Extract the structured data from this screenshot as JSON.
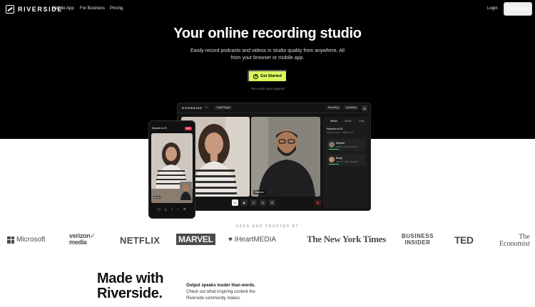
{
  "nav": {
    "brand": "RIVERSIDE",
    "links": [
      "Mobile App",
      "For Business",
      "Pricing"
    ],
    "login": "Login",
    "cta": "Get Started"
  },
  "hero": {
    "title": "Your online recording studio",
    "subtitle": "Easily record podcasts and videos in studio quality from anywhere. All from your browser or mobile app.",
    "cta": "Get Started",
    "note": "*No credit card required"
  },
  "studio": {
    "brand": "RIVERSIDE",
    "version": "2.0",
    "invite": "Invite People",
    "recording": "Recording",
    "uploading": "Uploading",
    "avatar": "N",
    "guest_tile_label": "Stephen",
    "tabs": [
      "Studio",
      "Media",
      "Chat"
    ],
    "episode_title": "Episode no.23",
    "episode_sub": "Audio & Video · 1080p local",
    "guests": [
      {
        "name": "Stephen",
        "meta": "Chrome · 87% uploaded"
      },
      {
        "name": "Becky",
        "meta": "Chrome · 90% uploaded"
      }
    ],
    "controls": [
      "●",
      "▶",
      "☷",
      "◎",
      "⚙"
    ],
    "leave": "✖"
  },
  "phone": {
    "episode": "Episode no.23",
    "rec": "REC",
    "tag": "Becky",
    "controls": [
      "▢",
      "△",
      "●",
      "○",
      "☰"
    ]
  },
  "trusted": {
    "label": "USED AND TRUSTED BY",
    "brands": {
      "microsoft": "Microsoft",
      "verizon_1": "verizon✓",
      "verizon_2": "media",
      "netflix": "NETFLIX",
      "marvel": "MARVEL",
      "iheart": "iHeartMEDIA",
      "nyt": "The New York Times",
      "bi_1": "BUSINESS",
      "bi_2": "INSIDER",
      "ted": "TED",
      "econ_1": "The",
      "econ_2": "Economist"
    }
  },
  "made": {
    "title_1": "Made with",
    "title_2": "Riverside.",
    "headline": "Output speaks louder than words.",
    "body": "Check out what inspiring content the Riverside community makes."
  },
  "colors": {
    "hero_bg": "#000000",
    "accent": "#d9f65c",
    "recording_red": "#e4324b",
    "upload_green": "#39d46b"
  }
}
